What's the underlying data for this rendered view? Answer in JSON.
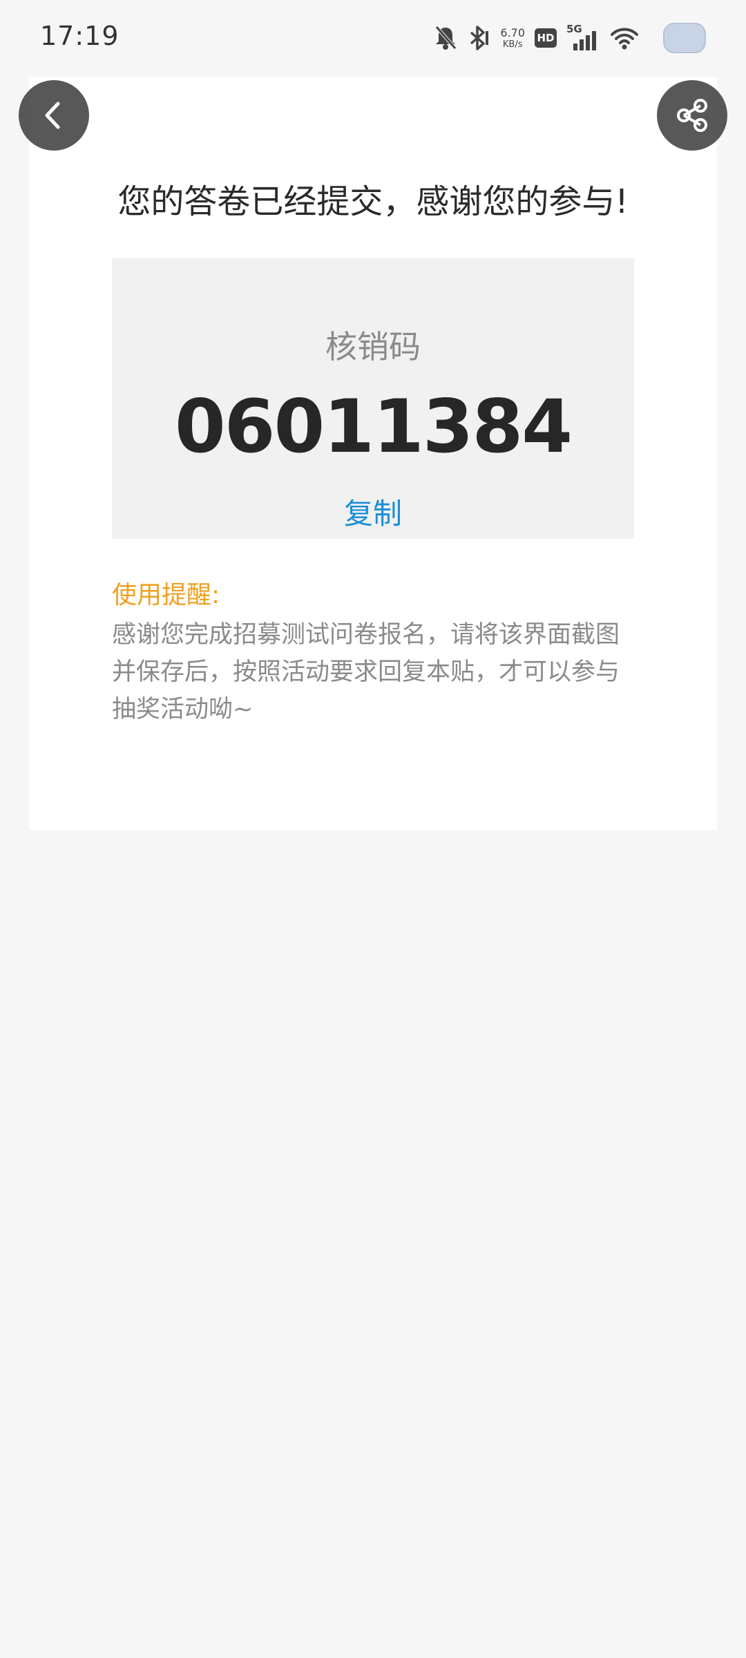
{
  "status_bar": {
    "time": "17:19",
    "net_speed_value": "6.70",
    "net_speed_unit": "KB/s",
    "hd_label": "HD",
    "network_label": "5G",
    "icons": [
      "bell-muted-icon",
      "bluetooth-icon",
      "hd-icon",
      "signal-5g-icon",
      "wifi-icon",
      "battery-icon"
    ]
  },
  "header": {
    "back_icon": "chevron-left-icon",
    "share_icon": "share-icon"
  },
  "result": {
    "title": "您的答卷已经提交，感谢您的参与!",
    "code_label": "核销码",
    "code_value": "06011384",
    "copy_label": "复制",
    "reminder_title": "使用提醒:",
    "reminder_text": "感谢您完成招募测试问卷报名，请将该界面截图并保存后，按照活动要求回复本贴，才可以参与抽奖活动呦~"
  },
  "colors": {
    "background": "#f6f6f6",
    "card": "#ffffff",
    "code_box": "#f1f1f1",
    "copy_link": "#1a8ed6",
    "reminder_title": "#f0a020",
    "fab": "#464646"
  }
}
